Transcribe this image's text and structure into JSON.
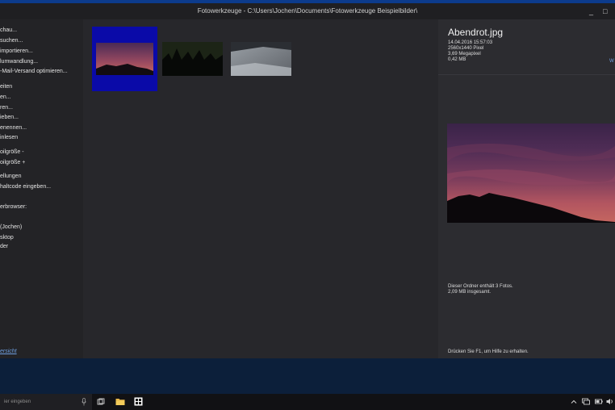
{
  "window": {
    "title": "Fotowerkzeuge - C:\\Users\\Jochen\\Documents\\Fotowerkzeuge Beispielbilder\\",
    "minimize_glyph": "_",
    "close_glyph": "□"
  },
  "sidebar": {
    "items": [
      "chau...",
      "suchen...",
      "importieren...",
      "lumwandlung...",
      "-Mail-Versand optimieren...",
      "eiten",
      "en...",
      "ren...",
      "ieben...",
      "enennen...",
      "inlesen",
      "oilgröße -",
      "oilgröße +",
      "ellungen",
      "haltcode eingeben...",
      "erbrowser:",
      "(Jochen)",
      "sktop",
      "der"
    ],
    "footer_link": "ersicht"
  },
  "thumbnails": [
    {
      "name": "sunset-thumbnail",
      "selected": true
    },
    {
      "name": "forest-thumbnail",
      "selected": false
    },
    {
      "name": "snow-thumbnail",
      "selected": false
    }
  ],
  "details": {
    "filename": "Abendrot.jpg",
    "date": "14.04.2016 15:57:03",
    "dimensions": "2560x1440 Pixel",
    "megapixels": "3,69 Megapixel",
    "size": "0,42 MB",
    "edge_link": "W",
    "folder_info_line1": "Dieser Ordner enthält 3 Fotos.",
    "folder_info_line2": "2,09 MB insgesamt.",
    "help": "Drücken Sie F1, um Hilfe zu erhalten."
  },
  "taskbar": {
    "search_placeholder": "ier eingeben"
  },
  "colors": {
    "selection": "#0a0aa8",
    "accent_strip": "#0c3b8c",
    "desktop": "#0c1f3a"
  }
}
